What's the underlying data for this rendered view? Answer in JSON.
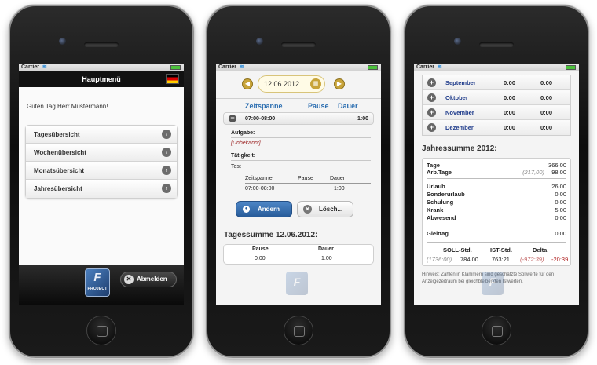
{
  "status": {
    "carrier": "Carrier"
  },
  "screen1": {
    "title": "Hauptmenü",
    "greeting": "Guten Tag Herr Mustermann!",
    "menu": [
      {
        "label": "Tagesübersicht"
      },
      {
        "label": "Wochenübersicht"
      },
      {
        "label": "Monatsübersicht"
      },
      {
        "label": "Jahresübersicht"
      }
    ],
    "logo_text": "PROJECT",
    "logout_label": "Abmelden"
  },
  "screen2": {
    "date": "12.06.2012",
    "columns": {
      "span": "Zeitspanne",
      "pause": "Pause",
      "duration": "Dauer"
    },
    "entry": {
      "span": "07:00-08:00",
      "duration": "1:00"
    },
    "task_label": "Aufgabe:",
    "task_value": "[Unbekannt]",
    "activity_label": "Tätigkeit:",
    "activity_value": "Test",
    "mini": {
      "span": "Zeitspanne",
      "pause": "Pause",
      "duration": "Dauer",
      "span_val": "07:00-08:00",
      "duration_val": "1:00"
    },
    "edit_button": "Ändern",
    "delete_button": "Lösch...",
    "sum_title": "Tagessumme 12.06.2012:",
    "sum": {
      "pause_label": "Pause",
      "duration_label": "Dauer",
      "pause": "0:00",
      "duration": "1:00"
    }
  },
  "screen3": {
    "months": [
      {
        "name": "September",
        "v1": "0:00",
        "v2": "0:00"
      },
      {
        "name": "Oktober",
        "v1": "0:00",
        "v2": "0:00"
      },
      {
        "name": "November",
        "v1": "0:00",
        "v2": "0:00"
      },
      {
        "name": "Dezember",
        "v1": "0:00",
        "v2": "0:00"
      }
    ],
    "year_title": "Jahressumme 2012:",
    "tage": {
      "label": "Tage",
      "value": "366,00"
    },
    "arbtage": {
      "label": "Arb.Tage",
      "gray": "(217,00)",
      "value": "98,00"
    },
    "urlaub": {
      "label": "Urlaub",
      "value": "26,00"
    },
    "sonderurlaub": {
      "label": "Sonderurlaub",
      "value": "0,00"
    },
    "schulung": {
      "label": "Schulung",
      "value": "0,00"
    },
    "krank": {
      "label": "Krank",
      "value": "5,00"
    },
    "abwesend": {
      "label": "Abwesend",
      "value": "0,00"
    },
    "gleittag": {
      "label": "Gleittag",
      "value": "0,00"
    },
    "soll": {
      "label": "SOLL-Std.",
      "gray": "(1736:00)",
      "value": "784:00"
    },
    "ist": {
      "label": "IST-Std.",
      "value": "763:21"
    },
    "delta": {
      "label": "Delta",
      "gray": "(-972:39)",
      "value": "-20:39"
    },
    "note": "Hinweis: Zahlen in Klammern sind geschätzte Sollwerte für den Anzeigezeitraum bei gleichbleibenden Istwerten."
  }
}
